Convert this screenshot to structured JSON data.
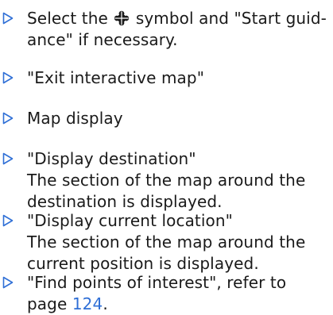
{
  "steps": [
    {
      "lines": {
        "l1a": "Select the",
        "l1b": "symbol and \"Start guid-",
        "l2": "ance\" if necessary."
      },
      "symbol_icon": "navigation-symbol-icon"
    },
    {
      "lines": {
        "l1": "\"Exit interactive map\""
      }
    },
    {
      "lines": {
        "l1": "Map display"
      }
    },
    {
      "lines": {
        "l1": "\"Display destination\"",
        "l2": "The section of the map around the",
        "l3": "destination is displayed."
      }
    },
    {
      "lines": {
        "l1": "\"Display current location\"",
        "l2": "The section of the map around the",
        "l3": "current position is displayed."
      }
    },
    {
      "lines": {
        "l1": "\"Find points of interest\", refer to",
        "l2a": "page",
        "l2b": "124",
        "l2c": "."
      }
    }
  ],
  "colors": {
    "text": "#1a1a1a",
    "bullet": "#2f6fd6",
    "link": "#2f6fd6"
  }
}
